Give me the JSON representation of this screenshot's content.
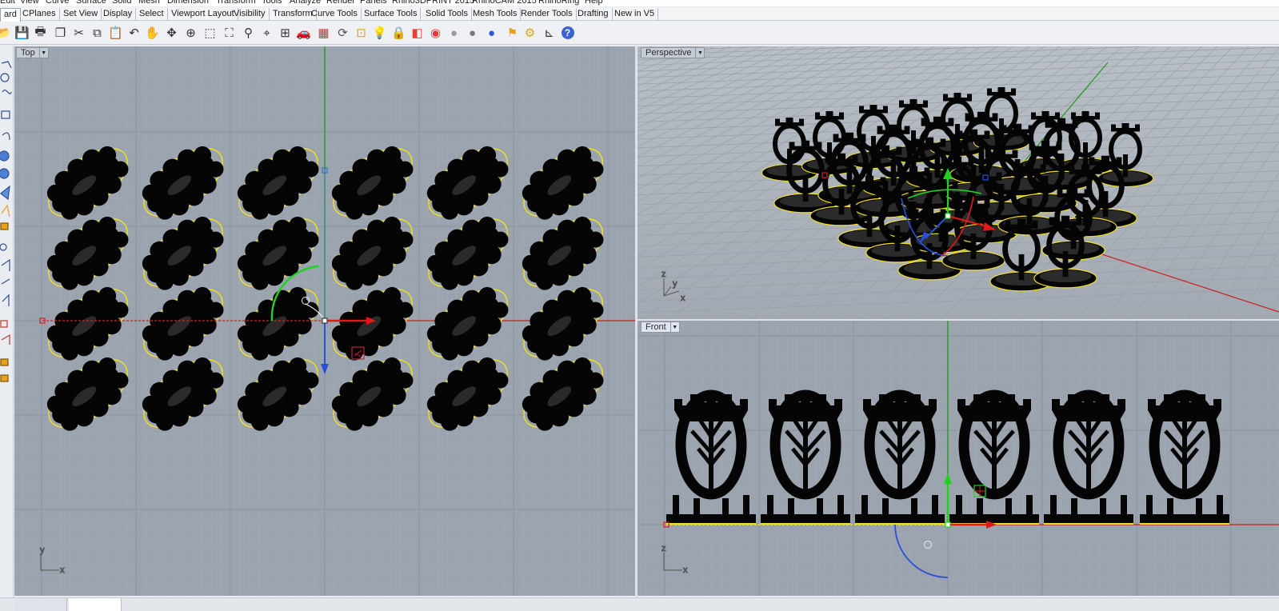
{
  "menubar": {
    "items": [
      "Edit",
      "View",
      "Curve",
      "Surface",
      "Solid",
      "Mesh",
      "Dimension",
      "Transform",
      "Tools",
      "Analyze",
      "Render",
      "Panels",
      "Rhino3DPRINT 2015",
      "RhinoCAM 2015",
      "RhinoRing",
      "Help"
    ]
  },
  "tabs": {
    "items": [
      "ard",
      "CPlanes",
      "Set View",
      "Display",
      "Select",
      "Viewport Layout",
      "Visibility",
      "Transform",
      "Curve Tools",
      "Surface Tools",
      "Solid Tools",
      "Mesh Tools",
      "Render Tools",
      "Drafting",
      "New in V5"
    ],
    "active_index": 0
  },
  "toolbar": {
    "icons": [
      "open-icon",
      "save-icon",
      "print-icon",
      "copy-file-icon",
      "cut-icon",
      "copy-icon",
      "paste-icon",
      "undo-icon",
      "pan-icon",
      "zoom-extents-icon",
      "zoom-in-icon",
      "zoom-window-icon",
      "zoom-all-icon",
      "zoom-selected-icon",
      "zoom-target-icon",
      "four-viewports-icon",
      "car-icon",
      "grid-icon",
      "rotate-view-icon",
      "object-snap-icon",
      "light-bulb-icon",
      "lock-icon",
      "layer-icon",
      "color-wheel-icon",
      "shaded-sphere-icon",
      "rendered-sphere-icon",
      "render-icon",
      "select-filter-icon",
      "gear-icon",
      "dimension-icon",
      "help-icon"
    ]
  },
  "viewports": {
    "top": {
      "title": "Top",
      "axis_labels": {
        "x": "x",
        "y": "y"
      }
    },
    "perspective": {
      "title": "Perspective",
      "axis_labels": {
        "x": "x",
        "y": "y",
        "z": "z"
      }
    },
    "front": {
      "title": "Front",
      "axis_labels": {
        "x": "x",
        "z": "z"
      }
    }
  },
  "colors": {
    "viewport_bg": "#9ba4ae",
    "perspective_bg": "#a7aeb7",
    "grid_minor": "#a3abb5",
    "grid_major": "#8b939d",
    "x_axis": "#d41f1f",
    "y_axis": "#1c9a1c",
    "selection": "#f4e11e",
    "object": "#050505",
    "gumball_z": "#1f3fd0"
  }
}
